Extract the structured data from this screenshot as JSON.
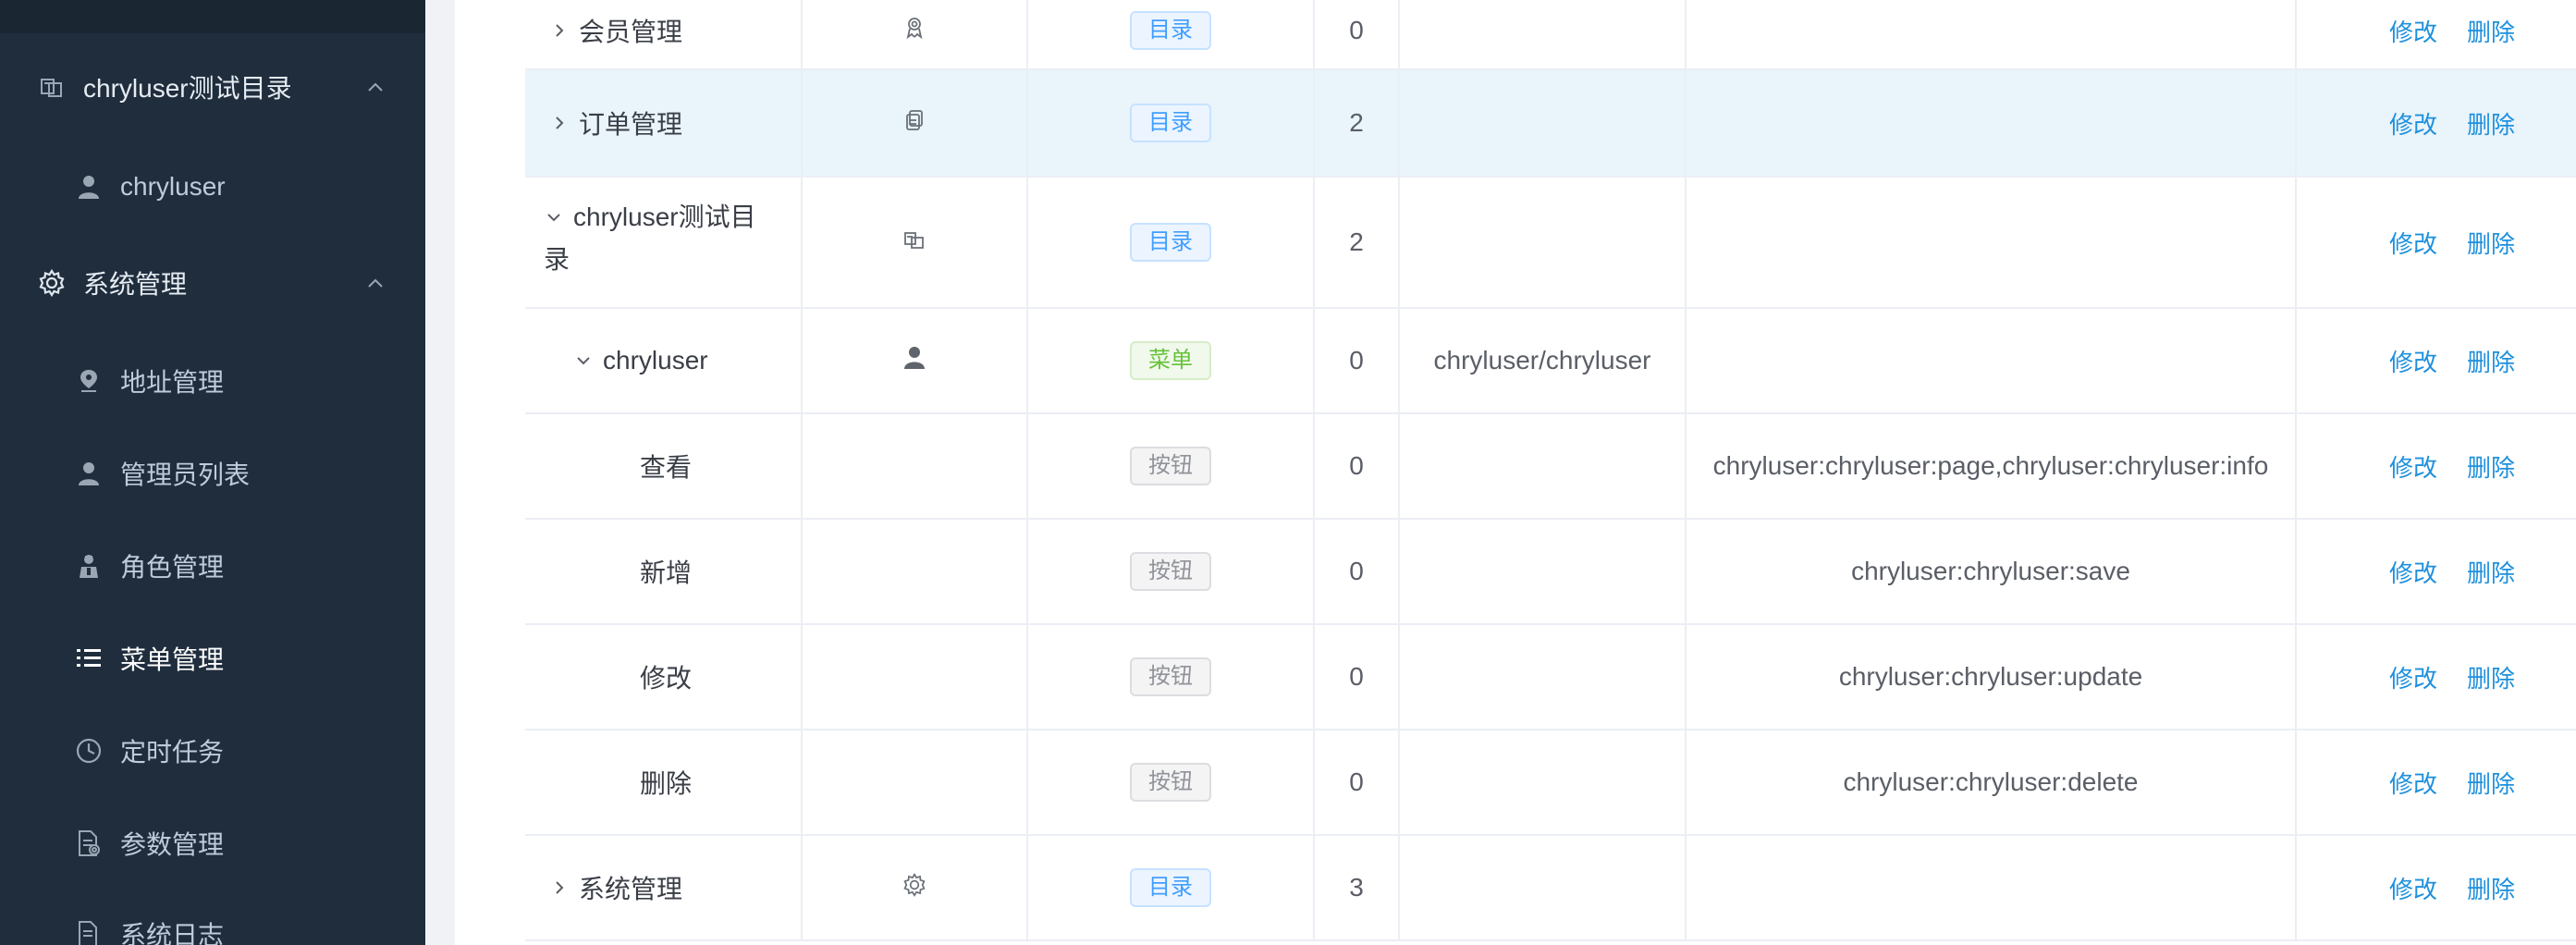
{
  "sidebar": {
    "items": [
      {
        "label": "chryluser测试目录",
        "icon": "directory-icon",
        "level": 1,
        "expanded": true
      },
      {
        "label": "chryluser",
        "icon": "user-icon",
        "level": 2
      },
      {
        "label": "系统管理",
        "icon": "gear-icon",
        "level": 1,
        "expanded": true
      },
      {
        "label": "地址管理",
        "icon": "location-icon",
        "level": 2
      },
      {
        "label": "管理员列表",
        "icon": "user-icon",
        "level": 2
      },
      {
        "label": "角色管理",
        "icon": "role-icon",
        "level": 2
      },
      {
        "label": "菜单管理",
        "icon": "list-icon",
        "level": 2,
        "active": true
      },
      {
        "label": "定时任务",
        "icon": "clock-icon",
        "level": 2
      },
      {
        "label": "参数管理",
        "icon": "document-icon",
        "level": 2
      },
      {
        "label": "系统日志",
        "icon": "log-icon",
        "level": 2
      }
    ]
  },
  "table": {
    "rows": [
      {
        "name": "会员管理",
        "expand": "collapsed",
        "indent": 0,
        "icon": "award-icon",
        "type": "目录",
        "type_kind": "dir",
        "sort": "0",
        "url": "",
        "perm": "",
        "edit": "修改",
        "delete": "删除"
      },
      {
        "name": "订单管理",
        "expand": "collapsed",
        "indent": 0,
        "icon": "copy-icon",
        "type": "目录",
        "type_kind": "dir",
        "sort": "2",
        "url": "",
        "perm": "",
        "edit": "修改",
        "delete": "删除",
        "highlight": true
      },
      {
        "name": "chryluser测试目",
        "name2": "录",
        "expand": "expanded",
        "indent": 0,
        "icon": "directory-icon",
        "type": "目录",
        "type_kind": "dir",
        "sort": "2",
        "url": "",
        "perm": "",
        "edit": "修改",
        "delete": "删除"
      },
      {
        "name": "chryluser",
        "expand": "expanded",
        "indent": 1,
        "icon": "user-icon",
        "type": "菜单",
        "type_kind": "menu",
        "sort": "0",
        "url": "chryluser/chryluser",
        "perm": "",
        "edit": "修改",
        "delete": "删除"
      },
      {
        "name": "查看",
        "expand": "none",
        "indent": 2,
        "icon": "",
        "type": "按钮",
        "type_kind": "btn",
        "sort": "0",
        "url": "",
        "perm": "chryluser:chryluser:page,chryluser:chryluser:info",
        "edit": "修改",
        "delete": "删除"
      },
      {
        "name": "新增",
        "expand": "none",
        "indent": 2,
        "icon": "",
        "type": "按钮",
        "type_kind": "btn",
        "sort": "0",
        "url": "",
        "perm": "chryluser:chryluser:save",
        "edit": "修改",
        "delete": "删除"
      },
      {
        "name": "修改",
        "expand": "none",
        "indent": 2,
        "icon": "",
        "type": "按钮",
        "type_kind": "btn",
        "sort": "0",
        "url": "",
        "perm": "chryluser:chryluser:update",
        "edit": "修改",
        "delete": "删除"
      },
      {
        "name": "删除",
        "expand": "none",
        "indent": 2,
        "icon": "",
        "type": "按钮",
        "type_kind": "btn",
        "sort": "0",
        "url": "",
        "perm": "chryluser:chryluser:delete",
        "edit": "修改",
        "delete": "删除"
      },
      {
        "name": "系统管理",
        "expand": "collapsed",
        "indent": 0,
        "icon": "gear-icon",
        "type": "目录",
        "type_kind": "dir",
        "sort": "3",
        "url": "",
        "perm": "",
        "edit": "修改",
        "delete": "删除"
      }
    ]
  },
  "colors": {
    "sidebar_bg": "#1f2d3d",
    "accent": "#409eff",
    "link": "#1e90dd",
    "row_highlight": "#e9f4fb"
  }
}
